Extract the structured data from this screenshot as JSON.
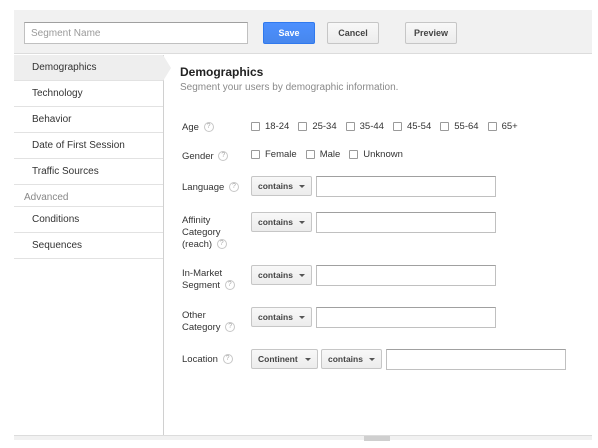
{
  "toolbar": {
    "segment_name_placeholder": "Segment Name",
    "save_label": "Save",
    "cancel_label": "Cancel",
    "preview_label": "Preview"
  },
  "sidebar": {
    "items": [
      {
        "label": "Demographics",
        "active": true
      },
      {
        "label": "Technology"
      },
      {
        "label": "Behavior"
      },
      {
        "label": "Date of First Session"
      },
      {
        "label": "Traffic Sources"
      }
    ],
    "advanced_heading": "Advanced",
    "advanced_items": [
      {
        "label": "Conditions"
      },
      {
        "label": "Sequences"
      }
    ]
  },
  "main": {
    "title": "Demographics",
    "subtitle": "Segment your users by demographic information.",
    "help_glyph": "?",
    "age": {
      "label": "Age",
      "options": [
        "18-24",
        "25-34",
        "35-44",
        "45-54",
        "55-64",
        "65+"
      ]
    },
    "gender": {
      "label": "Gender",
      "options": [
        "Female",
        "Male",
        "Unknown"
      ]
    },
    "language": {
      "label": "Language",
      "operator": "contains"
    },
    "affinity": {
      "label_lines": [
        "Affinity",
        "Category",
        "(reach)"
      ],
      "operator": "contains"
    },
    "in_market": {
      "label_lines": [
        "In-Market",
        "Segment"
      ],
      "operator": "contains"
    },
    "other_category": {
      "label_lines": [
        "Other",
        "Category"
      ],
      "operator": "contains"
    },
    "location": {
      "label": "Location",
      "scope": "Continent",
      "operator": "contains"
    }
  },
  "colors": {
    "primary_button": "#4d90fe",
    "sidebar_active": "#eeeeee",
    "toolbar_bg": "#f1f1f1"
  }
}
